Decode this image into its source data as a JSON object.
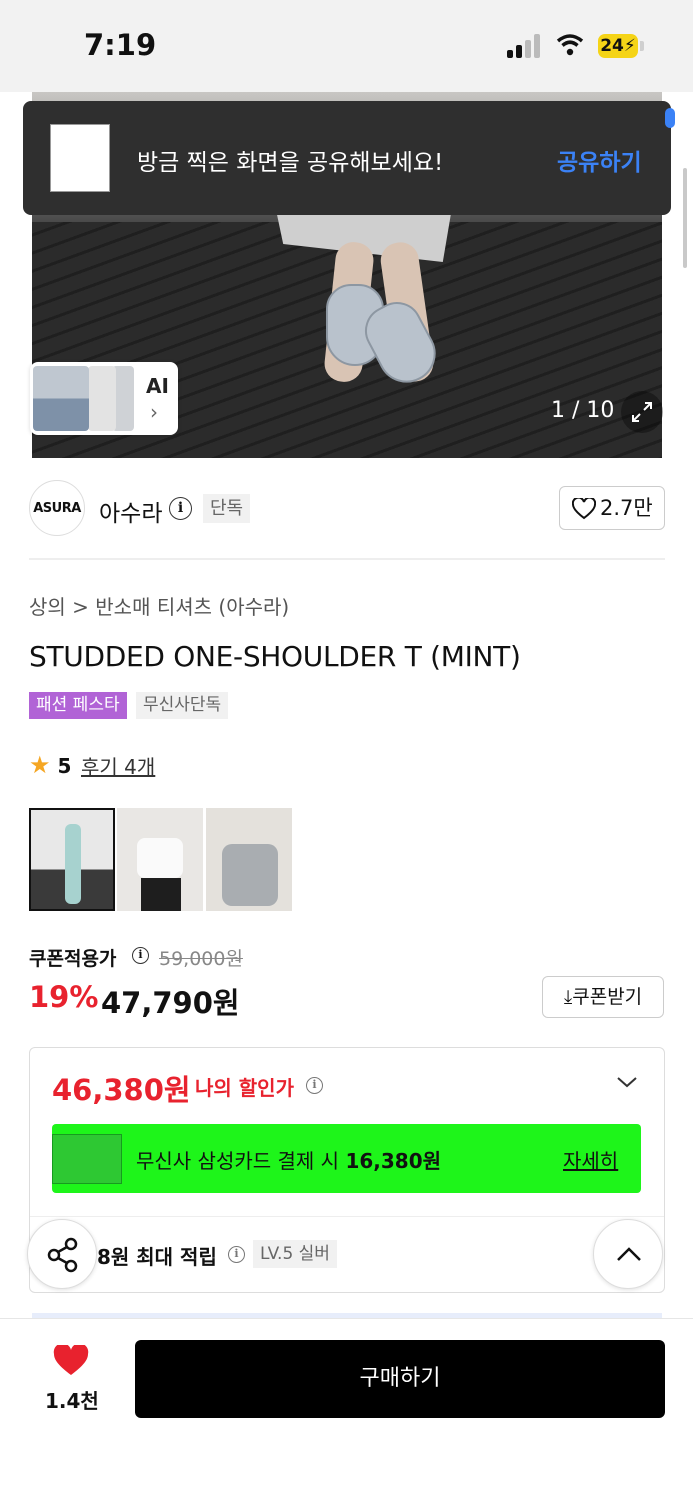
{
  "status_bar": {
    "time": "7:19",
    "battery": "24"
  },
  "toast": {
    "message": "방금 찍은 화면을 공유해보세요!",
    "action": "공유하기"
  },
  "gallery": {
    "ai_label": "AI",
    "counter": "1 / 10"
  },
  "brand": {
    "logo_text": "ASURA",
    "name": "아수라",
    "tag": "단독",
    "likes": "2.7만"
  },
  "breadcrumb": "상의 > 반소매 티셔츠 (아수라)",
  "product": {
    "title": "STUDDED ONE-SHOULDER T (MINT)",
    "badges": [
      "패션 페스타",
      "무신사단독"
    ],
    "rating": "5",
    "reviews": "후기 4개"
  },
  "price": {
    "coupon_label": "쿠폰적용가",
    "original": "59,000원",
    "discount": "19%",
    "sale": "47,790원",
    "coupon_button": "쿠폰받기"
  },
  "my_price": {
    "amount": "46,380원",
    "label": "나의 할인가",
    "card_promo": "무신사 삼성카드 결제 시 ",
    "card_promo_amount": "16,380원",
    "detail": "자세히",
    "points": "8원 최대 적립",
    "level": "LV.5 실버"
  },
  "bottom": {
    "wish_count": "1.4천",
    "buy": "구매하기"
  },
  "colors": {
    "accent_red": "#e8222e",
    "promo_green": "#1ef51a",
    "link_blue": "#3b82f6",
    "badge_purple": "#b163d6"
  }
}
